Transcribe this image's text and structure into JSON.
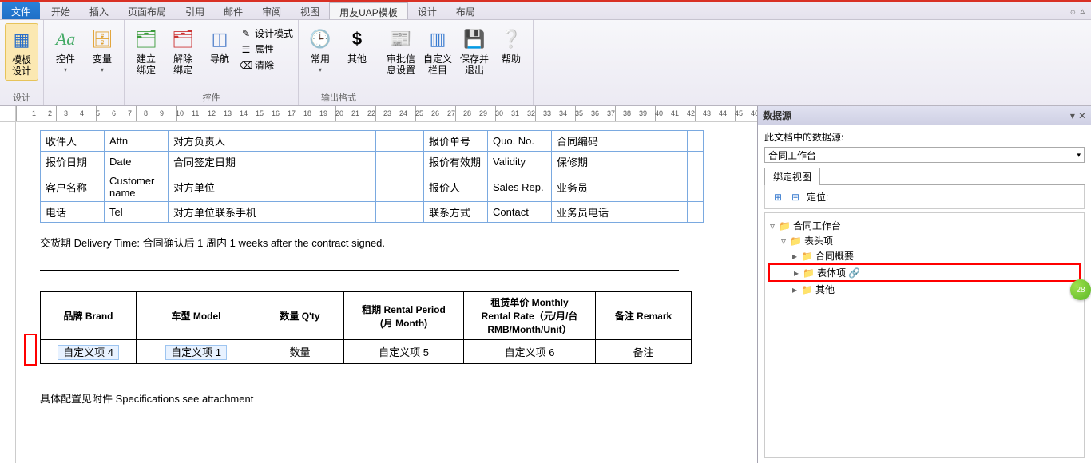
{
  "menu": {
    "file": "文件",
    "tabs": [
      "开始",
      "插入",
      "页面布局",
      "引用",
      "邮件",
      "审阅",
      "视图",
      "用友UAP模板",
      "设计",
      "布局"
    ],
    "active_index": 7
  },
  "ribbon": {
    "g1": {
      "label": "设计",
      "btn1": "模板\n设计"
    },
    "g2": {
      "label": "",
      "btn1": "控件",
      "btn2": "变量"
    },
    "g3": {
      "label": "控件",
      "btn1": "建立\n绑定",
      "btn2": "解除\n绑定",
      "btn3": "导航",
      "small": [
        "设计模式",
        "属性",
        "清除"
      ]
    },
    "g4": {
      "label": "输出格式",
      "btn1": "常用",
      "btn2": "其他"
    },
    "g5": {
      "label": "",
      "btn1": "审批信\n息设置",
      "btn2": "自定义\n栏目",
      "btn3": "保存并\n退出",
      "btn4": "帮助"
    }
  },
  "table1": [
    [
      "收件人",
      "Attn",
      "对方负责人",
      "",
      "报价单号",
      "Quo. No.",
      "合同编码",
      ""
    ],
    [
      "报价日期",
      "Date",
      "合同签定日期",
      "",
      "报价有效期",
      "Validity",
      "保修期",
      ""
    ],
    [
      "客户名称",
      "Customer name",
      "对方单位",
      "",
      "报价人",
      "Sales Rep.",
      "业务员",
      ""
    ],
    [
      "电话",
      "Tel",
      "对方单位联系手机",
      "",
      "联系方式",
      "Contact",
      "业务员电话",
      ""
    ]
  ],
  "delivery": "交货期 Delivery Time: 合同确认后  1  周内     1     weeks after the contract signed.",
  "table2_head": [
    "品牌 Brand",
    "车型 Model",
    "数量 Q'ty",
    "租期 Rental Period\n(月 Month)",
    "租赁单价 Monthly\nRental Rate（元/月/台\nRMB/Month/Unit）",
    "备注 Remark"
  ],
  "table2_row": [
    "自定义项 4",
    "自定义项 1",
    "数量",
    "自定义项 5",
    "自定义项 6",
    "备注"
  ],
  "footer_text": "具体配置见附件  Specifications see attachment",
  "panel": {
    "title": "数据源",
    "desc": "此文档中的数据源:",
    "combo": "合同工作台",
    "tab": "绑定视图",
    "locate": "定位:",
    "tree": [
      {
        "lvl": 0,
        "tw": "▿",
        "txt": "合同工作台"
      },
      {
        "lvl": 1,
        "tw": "▿",
        "txt": "表头项"
      },
      {
        "lvl": 2,
        "tw": "▸",
        "txt": "合同概要"
      },
      {
        "lvl": 2,
        "tw": "▸",
        "txt": "表体项",
        "link": true,
        "hl": true
      },
      {
        "lvl": 2,
        "tw": "▸",
        "txt": "其他"
      }
    ]
  },
  "bubble": "28"
}
